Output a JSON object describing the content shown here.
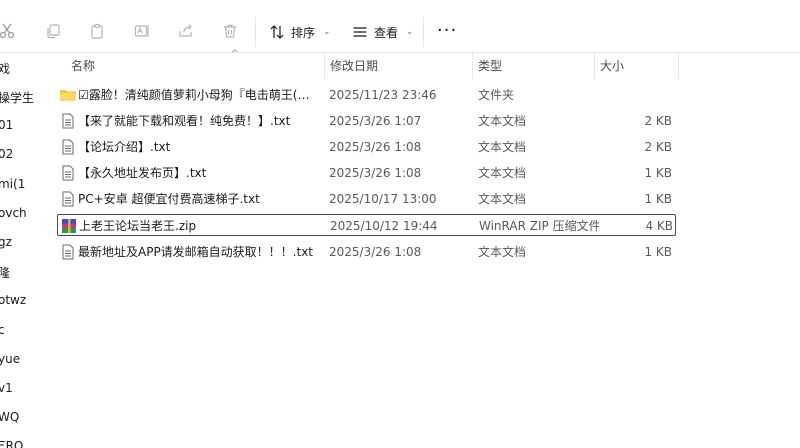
{
  "toolbar": {
    "icons": [
      "cut-icon",
      "copy-icon",
      "paste-icon",
      "rename-icon",
      "share-icon",
      "delete-icon"
    ],
    "sort_label": "排序",
    "view_label": "查看",
    "more_label": "···"
  },
  "nav": {
    "items": [
      "戏",
      "操学生",
      "01",
      "02",
      "mi(1",
      "ovch",
      "gz",
      "隆",
      "otwz",
      "c",
      "yue",
      "v1",
      "WQ",
      "ΞRO"
    ]
  },
  "columns": {
    "name": "名称",
    "date": "修改日期",
    "type": "类型",
    "size": "大小"
  },
  "files": [
    {
      "icon": "folder-icon",
      "name": "☑露脸！清纯颜值萝莉小母狗『电击萌王(men...",
      "date": "2025/11/23 23:46",
      "type": "文件夹",
      "size": ""
    },
    {
      "icon": "text-file-icon",
      "name": "【来了就能下载和观看！纯免费！】.txt",
      "date": "2025/3/26 1:07",
      "type": "文本文档",
      "size": "2 KB"
    },
    {
      "icon": "text-file-icon",
      "name": "【论坛介绍】.txt",
      "date": "2025/3/26 1:08",
      "type": "文本文档",
      "size": "2 KB"
    },
    {
      "icon": "text-file-icon",
      "name": "【永久地址发布页】.txt",
      "date": "2025/3/26 1:08",
      "type": "文本文档",
      "size": "1 KB"
    },
    {
      "icon": "text-file-icon",
      "name": "PC+安卓 超便宜付费高速梯子.txt",
      "date": "2025/10/17 13:00",
      "type": "文本文档",
      "size": "1 KB"
    },
    {
      "icon": "winrar-zip-icon",
      "name": "上老王论坛当老王.zip",
      "date": "2025/10/12 19:44",
      "type": "WinRAR ZIP 压缩文件",
      "size": "4 KB"
    },
    {
      "icon": "text-file-icon",
      "name": "最新地址及APP请发邮箱自动获取！！！.txt",
      "date": "2025/3/26 1:08",
      "type": "文本文档",
      "size": "1 KB"
    }
  ],
  "selected_index": 5,
  "colors": {
    "folder": "#f5c242",
    "selection_border": "#4b4b4b",
    "toolbar_icon_disabled": "#b5b5b5"
  }
}
